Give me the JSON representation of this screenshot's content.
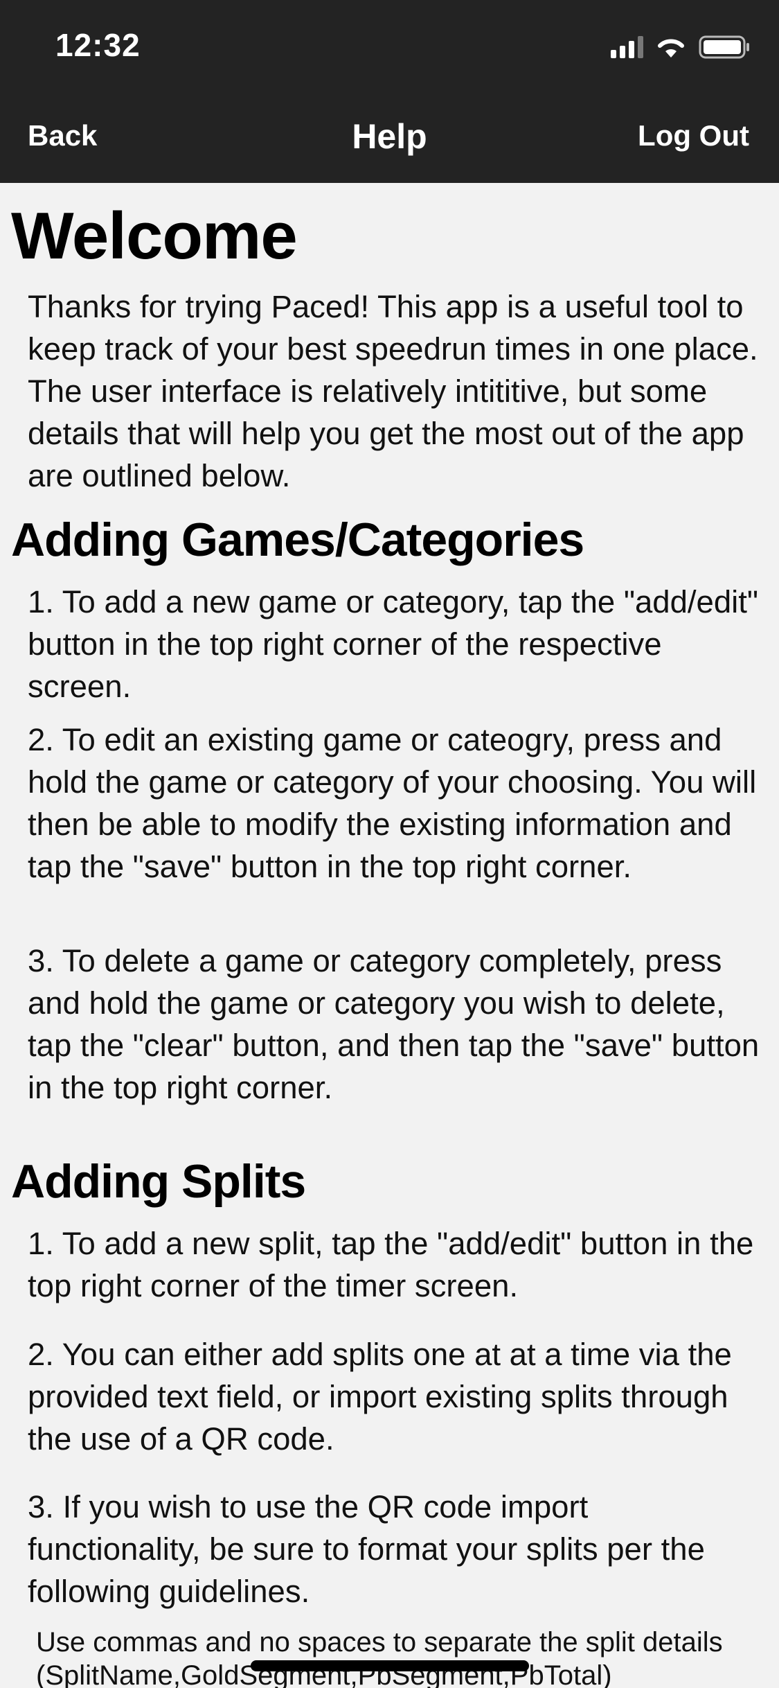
{
  "status_bar": {
    "time": "12:32",
    "icons": [
      "cellular-signal-icon",
      "wifi-icon",
      "battery-icon"
    ]
  },
  "nav": {
    "back_label": "Back",
    "title": "Help",
    "logout_label": "Log Out"
  },
  "colors": {
    "bar_background": "#232323",
    "page_background": "#f2f2f2",
    "text": "#000000"
  },
  "help": {
    "welcome": {
      "heading": "Welcome",
      "body": "Thanks for trying Paced! This app is a useful tool to keep track of your best speedrun times in one place. The user interface is relatively intititive, but some details that will help you get the most out of the app are outlined below."
    },
    "games": {
      "heading": "Adding Games/Categories",
      "steps": [
        "1. To add a new game or category, tap the \"add/edit\" button in the top right corner of the respective screen.",
        "2. To edit an existing game or cateogry, press and hold the game or category of your choosing. You will then be able to modify the existing information and tap the \"save\" button in the top right corner.",
        "3. To delete a game or category completely, press and hold the game or category you wish to delete, tap the \"clear\" button, and then tap the \"save\" button in the top right corner."
      ]
    },
    "splits": {
      "heading": "Adding Splits",
      "steps": [
        "1. To add a new split, tap the \"add/edit\" button in the top right corner of the timer screen.",
        "2. You can either add splits one at at a time via the provided text field, or import existing splits through the use of a QR code.",
        "3. If you wish to use the QR code import functionality, be sure to format your splits per the following guidelines."
      ],
      "format_note": "Use commas and no spaces to separate the split details (SplitName,GoldSegment,PbSegment,PbTotal)"
    }
  }
}
